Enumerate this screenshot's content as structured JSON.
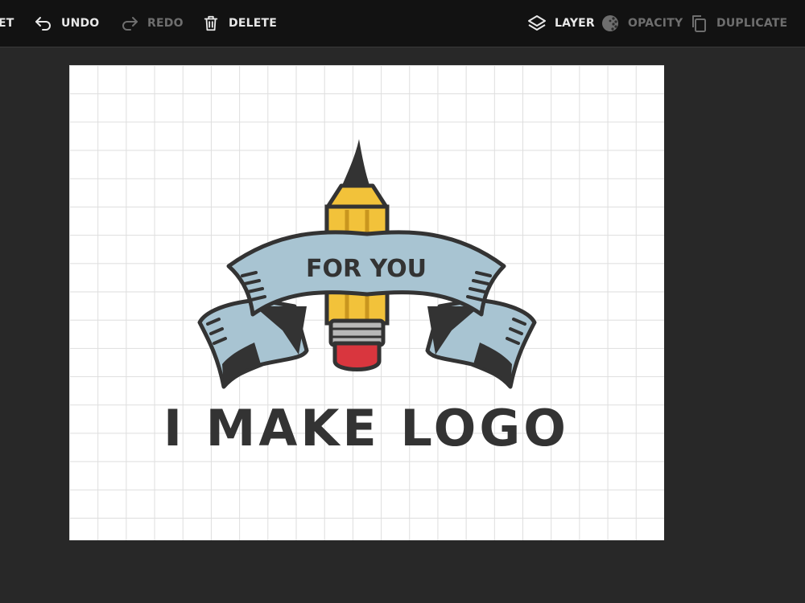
{
  "toolbar": {
    "reset_label": "ET",
    "undo_label": "UNDO",
    "redo_label": "REDO",
    "delete_label": "DELETE",
    "layer_label": "LAYER",
    "opacity_label": "OPACITY",
    "duplicate_label": "DUPLICATE",
    "icons": {
      "undo": "undo-arrow-icon",
      "redo": "redo-arrow-icon",
      "delete": "trash-icon",
      "layer": "layers-icon",
      "opacity": "opacity-icon",
      "duplicate": "duplicate-icon"
    },
    "enabled_color": "#e8e8e8",
    "disabled_color": "#6e6e6e"
  },
  "canvas": {
    "background": "#ffffff",
    "grid_color": "#dedede",
    "logo": {
      "banner_text": "FOR YOU",
      "main_text": "I MAKE LOGO",
      "colors": {
        "ink": "#333333",
        "banner": "#a8c4d2",
        "pencil": "#f2c23a",
        "eraser": "#d9363e",
        "ferrule": "#b8b8b8"
      }
    }
  }
}
